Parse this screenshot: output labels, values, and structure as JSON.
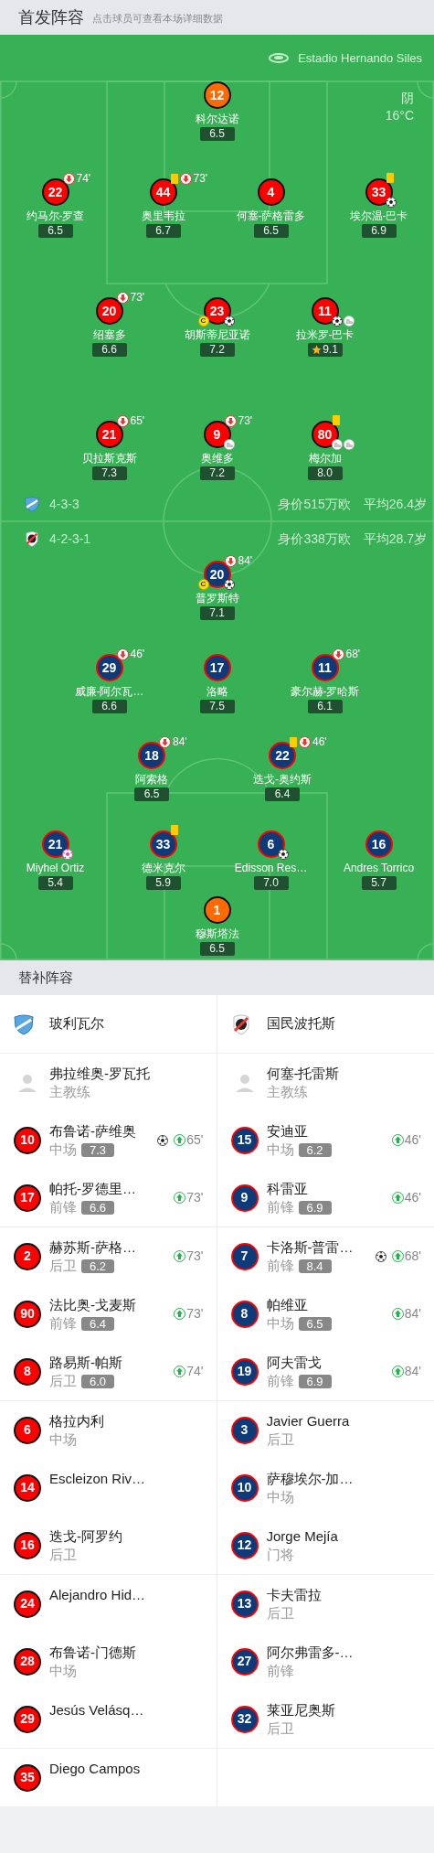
{
  "header": {
    "title": "首发阵容",
    "hint": "点击球员可查看本场详细数据"
  },
  "pitch": {
    "stadium": "Estadio Hernando Siles",
    "weather": "阴",
    "temperature": "16°C",
    "teams": [
      {
        "formation": "4-3-3",
        "value": "身价515万欧",
        "avg_age": "平均26.4岁",
        "keeper": {
          "number": "12",
          "name": "科尔达诺",
          "rating": "6.5",
          "best": false
        },
        "rows": [
          [
            {
              "number": "22",
              "name": "约马尔-罗查",
              "rating": "6.5",
              "best": false,
              "events": [
                {
                  "kind": "sub_off",
                  "minute": "74'"
                }
              ]
            },
            {
              "number": "44",
              "name": "奥里韦拉",
              "rating": "6.7",
              "best": false,
              "events": [
                {
                  "kind": "yellow"
                },
                {
                  "kind": "sub_off",
                  "minute": "73'"
                }
              ]
            },
            {
              "number": "4",
              "name": "何塞-萨格雷多",
              "rating": "6.5",
              "best": false
            },
            {
              "number": "33",
              "name": "埃尔温-巴卡",
              "rating": "6.9",
              "best": false,
              "events": [
                {
                  "kind": "yellow"
                },
                {
                  "kind": "goal"
                }
              ]
            }
          ],
          [
            {
              "number": "20",
              "name": "绍塞多",
              "rating": "6.6",
              "best": false,
              "events": [
                {
                  "kind": "sub_off",
                  "minute": "73'"
                }
              ]
            },
            {
              "number": "23",
              "name": "胡斯蒂尼亚诺",
              "rating": "7.2",
              "captain_label": "C",
              "best": false,
              "events": [
                {
                  "kind": "goal"
                }
              ]
            },
            {
              "number": "11",
              "name": "拉米罗-巴卡",
              "rating": "9.1",
              "best": true,
              "events": [
                {
                  "kind": "goal"
                },
                {
                  "kind": "assist"
                }
              ]
            }
          ],
          [
            {
              "number": "21",
              "name": "贝拉斯克斯",
              "rating": "7.3",
              "best": false,
              "events": [
                {
                  "kind": "sub_off",
                  "minute": "65'"
                }
              ]
            },
            {
              "number": "9",
              "name": "奥维多",
              "rating": "7.2",
              "best": false,
              "events": [
                {
                  "kind": "sub_off",
                  "minute": "73'"
                },
                {
                  "kind": "assist"
                }
              ]
            },
            {
              "number": "80",
              "name": "梅尔加",
              "rating": "8.0",
              "best": false,
              "events": [
                {
                  "kind": "yellow"
                },
                {
                  "kind": "assist"
                },
                {
                  "kind": "assist"
                }
              ]
            }
          ]
        ]
      },
      {
        "formation": "4-2-3-1",
        "value": "身价338万欧",
        "avg_age": "平均28.7岁",
        "rows": [
          [
            {
              "number": "20",
              "name": "普罗斯特",
              "rating": "7.1",
              "captain_label": "C",
              "best": false,
              "events": [
                {
                  "kind": "sub_off",
                  "minute": "84'"
                },
                {
                  "kind": "goal"
                }
              ]
            }
          ],
          [
            {
              "number": "29",
              "name": "威廉-阿尔瓦…",
              "rating": "6.6",
              "best": false,
              "events": [
                {
                  "kind": "sub_off",
                  "minute": "46'"
                }
              ]
            },
            {
              "number": "17",
              "name": "洛略",
              "rating": "7.5",
              "best": false
            },
            {
              "number": "11",
              "name": "豪尔赫-罗哈斯",
              "rating": "6.1",
              "best": false,
              "events": [
                {
                  "kind": "sub_off",
                  "minute": "68'"
                }
              ]
            }
          ],
          [
            {
              "number": "18",
              "name": "阿索格",
              "rating": "6.5",
              "best": false,
              "events": [
                {
                  "kind": "sub_off",
                  "minute": "84'"
                }
              ]
            },
            {
              "number": "22",
              "name": "迭戈-奥约斯",
              "rating": "6.4",
              "best": false,
              "events": [
                {
                  "kind": "yellow"
                },
                {
                  "kind": "sub_off",
                  "minute": "46'"
                }
              ]
            }
          ],
          [
            {
              "number": "21",
              "name": "Miyhel Ortiz",
              "rating": "5.4",
              "best": false,
              "events": [
                {
                  "kind": "own_goal"
                }
              ]
            },
            {
              "number": "33",
              "name": "德米克尔",
              "rating": "5.9",
              "best": false,
              "events": [
                {
                  "kind": "yellow"
                }
              ]
            },
            {
              "number": "6",
              "name": "Edisson Res…",
              "rating": "7.0",
              "best": false,
              "events": [
                {
                  "kind": "goal"
                }
              ]
            },
            {
              "number": "16",
              "name": "Andres Torrico",
              "rating": "5.7",
              "best": false
            }
          ]
        ],
        "keeper": {
          "number": "1",
          "name": "穆斯塔法",
          "rating": "6.5",
          "best": false
        }
      }
    ]
  },
  "subs": {
    "title": "替补阵容",
    "teams": [
      {
        "name": "玻利瓦尔",
        "coach": {
          "name": "弗拉维奥-罗瓦托",
          "role": "主教练"
        },
        "players": [
          {
            "number": "10",
            "name": "布鲁诺-萨维奥",
            "position": "中场",
            "rating": "7.3",
            "events": [
              {
                "kind": "goal"
              },
              {
                "kind": "sub_on",
                "minute": "65'"
              }
            ]
          },
          {
            "number": "17",
            "name": "帕托-罗德里…",
            "position": "前锋",
            "rating": "6.6",
            "events": [
              {
                "kind": "sub_on",
                "minute": "73'"
              }
            ]
          },
          {
            "number": "2",
            "name": "赫苏斯-萨格…",
            "position": "后卫",
            "rating": "6.2",
            "events": [
              {
                "kind": "sub_on",
                "minute": "73'"
              }
            ]
          },
          {
            "number": "90",
            "name": "法比奥-戈麦斯",
            "position": "前锋",
            "rating": "6.4",
            "events": [
              {
                "kind": "sub_on",
                "minute": "73'"
              }
            ]
          },
          {
            "number": "8",
            "name": "路易斯-帕斯",
            "position": "后卫",
            "rating": "6.0",
            "events": [
              {
                "kind": "sub_on",
                "minute": "74'"
              }
            ]
          },
          {
            "number": "6",
            "name": "格拉内利",
            "position": "中场"
          },
          {
            "number": "14",
            "name": "Escleizon Riv…"
          },
          {
            "number": "16",
            "name": "迭戈-阿罗约",
            "position": "后卫"
          },
          {
            "number": "24",
            "name": "Alejandro Hid…"
          },
          {
            "number": "28",
            "name": "布鲁诺-门德斯",
            "position": "中场"
          },
          {
            "number": "29",
            "name": "Jesús Velásq…"
          },
          {
            "number": "35",
            "name": "Diego Campos"
          }
        ]
      },
      {
        "name": "国民波托斯",
        "coach": {
          "name": "何塞-托雷斯",
          "role": "主教练"
        },
        "players": [
          {
            "number": "15",
            "name": "安迪亚",
            "position": "中场",
            "rating": "6.2",
            "events": [
              {
                "kind": "sub_on",
                "minute": "46'"
              }
            ]
          },
          {
            "number": "9",
            "name": "科雷亚",
            "position": "前锋",
            "rating": "6.9",
            "events": [
              {
                "kind": "sub_on",
                "minute": "46'"
              }
            ]
          },
          {
            "number": "7",
            "name": "卡洛斯-普雷…",
            "position": "前锋",
            "rating": "8.4",
            "events": [
              {
                "kind": "goal"
              },
              {
                "kind": "sub_on",
                "minute": "68'"
              }
            ]
          },
          {
            "number": "8",
            "name": "帕维亚",
            "position": "中场",
            "rating": "6.5",
            "events": [
              {
                "kind": "sub_on",
                "minute": "84'"
              }
            ]
          },
          {
            "number": "19",
            "name": "阿夫雷戈",
            "position": "前锋",
            "rating": "6.9",
            "events": [
              {
                "kind": "sub_on",
                "minute": "84'"
              }
            ]
          },
          {
            "number": "3",
            "name": "Javier Guerra",
            "position": "后卫"
          },
          {
            "number": "10",
            "name": "萨穆埃尔-加…",
            "position": "中场"
          },
          {
            "number": "12",
            "name": "Jorge Mejía",
            "position": "门将"
          },
          {
            "number": "13",
            "name": "卡夫雷拉",
            "position": "后卫"
          },
          {
            "number": "27",
            "name": "阿尔弗雷多-…",
            "position": "前锋"
          },
          {
            "number": "32",
            "name": "莱亚尼奥斯",
            "position": "后卫"
          }
        ]
      }
    ]
  }
}
